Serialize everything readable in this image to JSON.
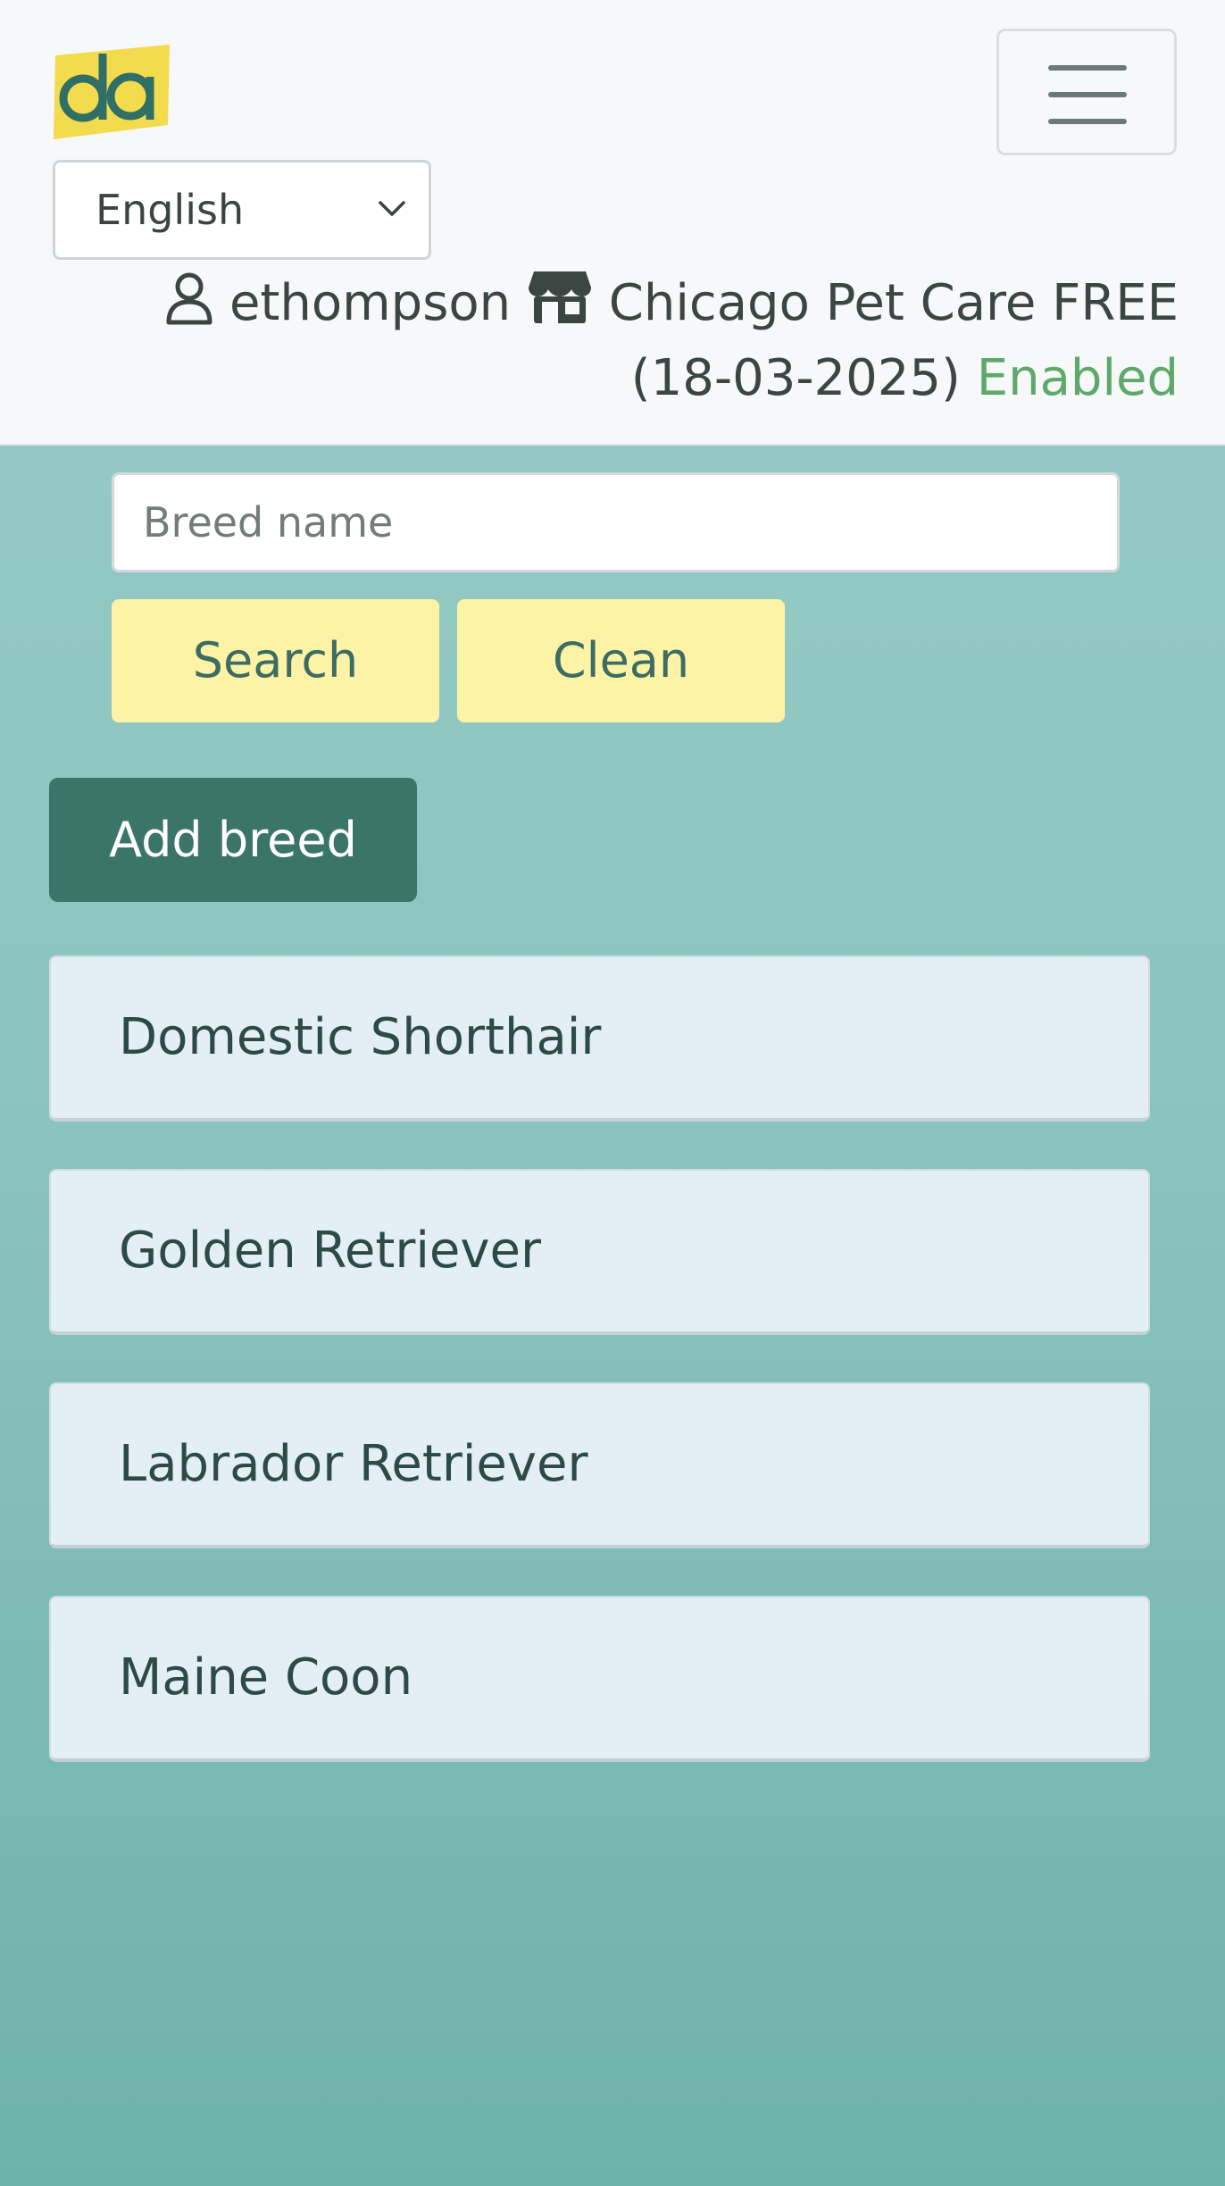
{
  "header": {
    "logo_text": "da",
    "language": {
      "selected": "English"
    },
    "user": {
      "username": "ethompson",
      "business": "Chicago Pet Care",
      "plan": "FREE",
      "date": "(18-03-2025)",
      "status": "Enabled"
    },
    "colors": {
      "status_enabled": "#5ea86a",
      "logo_bg": "#f3db4e",
      "logo_fg": "#2f6f66"
    }
  },
  "search": {
    "placeholder": "Breed name",
    "search_label": "Search",
    "clean_label": "Clean"
  },
  "actions": {
    "add_label": "Add breed"
  },
  "breeds": [
    {
      "name": "Domestic Shorthair"
    },
    {
      "name": "Golden Retriever"
    },
    {
      "name": "Labrador Retriever"
    },
    {
      "name": "Maine Coon"
    }
  ],
  "icons": {
    "menu": "hamburger-menu-icon",
    "user": "user-icon",
    "store": "store-icon",
    "dropdown": "chevron-down-icon"
  }
}
